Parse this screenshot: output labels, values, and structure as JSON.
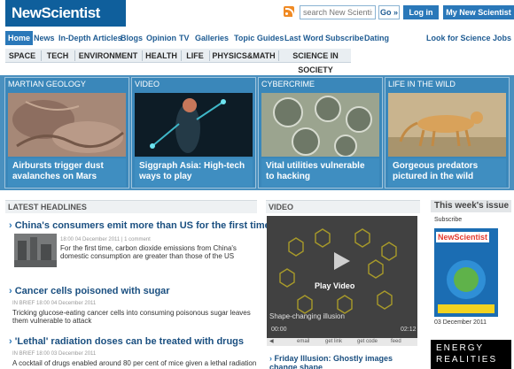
{
  "header": {
    "logo": "NewScientist",
    "search": {
      "placeholder": "search New Scientist",
      "go_label": "Go »"
    },
    "login_label": "Log in",
    "my_account_label": "My New Scientist"
  },
  "nav": {
    "items": [
      "Home",
      "News",
      "In-Depth Articles",
      "Blogs",
      "Opinion",
      "TV",
      "Galleries",
      "Topic Guides",
      "Last Word",
      "Subscribe",
      "Dating"
    ],
    "active": "Home",
    "right_link": "Look for Science Jobs"
  },
  "sections": [
    "SPACE",
    "TECH",
    "ENVIRONMENT",
    "HEALTH",
    "LIFE",
    "PHYSICS&MATH",
    "SCIENCE IN SOCIETY"
  ],
  "features": [
    {
      "label": "MARTIAN GEOLOGY",
      "caption": "Airbursts trigger dust avalanches on Mars"
    },
    {
      "label": "VIDEO",
      "caption": "Siggraph Asia: High-tech ways to play"
    },
    {
      "label": "CYBERCRIME",
      "caption": "Vital utilities vulnerable to hacking"
    },
    {
      "label": "LIFE IN THE WILD",
      "caption": "Gorgeous predators pictured in the wild"
    }
  ],
  "headlines": {
    "title": "LATEST HEADLINES",
    "items": [
      {
        "title": "China's consumers emit more than US for the first time",
        "meta": "18:00 04 December 2011 | 1 comment",
        "body": "For the first time, carbon dioxide emissions from China's domestic consumption are greater than those of the US"
      },
      {
        "title": "Cancer cells poisoned with sugar",
        "meta": "IN BRIEF  18:00 04 December 2011",
        "body": "Tricking glucose-eating cancer cells into consuming poisonous sugar leaves them vulnerable to attack"
      },
      {
        "title": "'Lethal' radiation doses can be treated with drugs",
        "meta": "IN BRIEF  18:00 03 December 2011",
        "body": "A cocktail of drugs enabled around 80 per cent of mice given a lethal radiation"
      }
    ]
  },
  "video": {
    "title": "VIDEO",
    "play_label": "Play Video",
    "caption": "Shape-changing illusion",
    "time_start": "00:00",
    "time_end": "02:12",
    "controls": [
      "email",
      "get link",
      "get code",
      "feed"
    ],
    "next_title": "Friday Illusion: Ghostly images change shape"
  },
  "sidebar": {
    "title": "This week's issue",
    "subscribe": "Subscribe",
    "cover_logo": "NewScientist",
    "date": "03 December 2011",
    "ad_text": "ENERGY REALITIES"
  },
  "colors": {
    "brand": "#0f5f9c",
    "accent": "#2a78b9",
    "feature_band": "#4a90bf",
    "headline": "#1a4f80"
  }
}
